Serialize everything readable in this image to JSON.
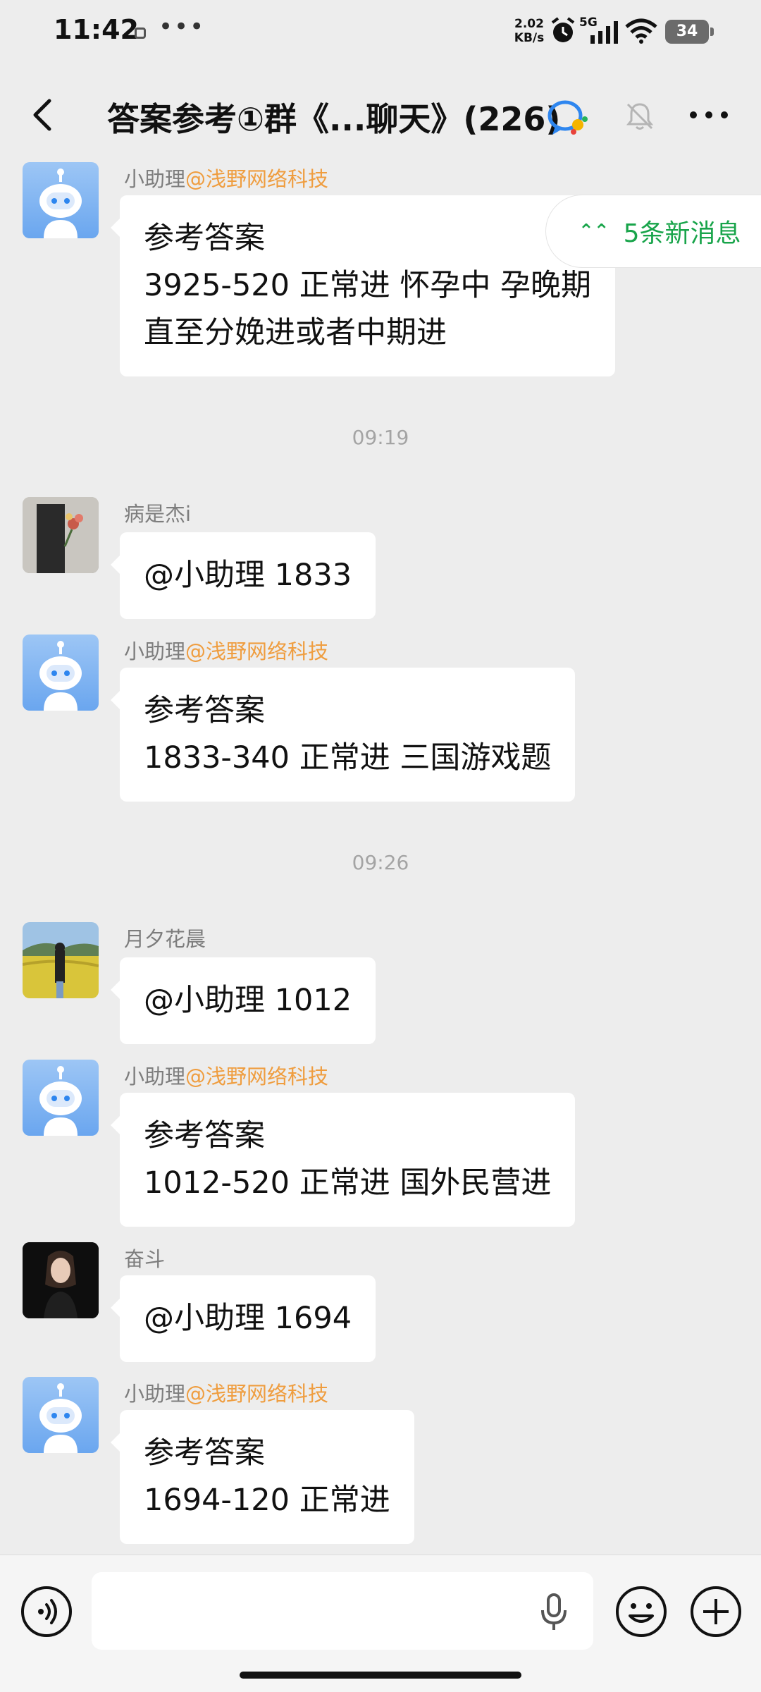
{
  "status_bar": {
    "time": "11:42",
    "net_speed_value": "2.02",
    "net_speed_unit": "KB/s",
    "network": "5G",
    "battery": "34",
    "icons": [
      "notification-icon",
      "alarm-icon",
      "signal-icon",
      "wifi-icon",
      "battery-icon"
    ]
  },
  "header": {
    "title": "答案参考①群《...聊天》(226)",
    "icons": [
      "back-icon",
      "group-badge-icon",
      "mute-bell-icon",
      "more-icon"
    ]
  },
  "new_messages_pill": {
    "label": "5条新消息",
    "icon": "double-chevron-up-icon"
  },
  "messages": [
    {
      "sender": "小助理",
      "org": "@浅野网络科技",
      "avatar": "robot",
      "lines": [
        "参考答案",
        "3925-520 正常进 怀孕中 孕晚期",
        "直至分娩进或者中期进"
      ]
    },
    {
      "timestamp": "09:19"
    },
    {
      "sender": "病是杰i",
      "avatar": "photo-flowers",
      "lines": [
        "@小助理  1833"
      ]
    },
    {
      "sender": "小助理",
      "org": "@浅野网络科技",
      "avatar": "robot",
      "lines": [
        "参考答案",
        "1833-340 正常进 三国游戏题"
      ]
    },
    {
      "timestamp": "09:26"
    },
    {
      "sender": "月夕花晨",
      "avatar": "photo-field",
      "lines": [
        "@小助理  1012"
      ]
    },
    {
      "sender": "小助理",
      "org": "@浅野网络科技",
      "avatar": "robot",
      "lines": [
        "参考答案",
        "1012-520 正常进 国外民营进"
      ]
    },
    {
      "sender": "奋斗",
      "avatar": "photo-portrait",
      "lines": [
        "@小助理  1694"
      ]
    },
    {
      "sender": "小助理",
      "org": "@浅野网络科技",
      "avatar": "robot",
      "lines": [
        "参考答案",
        "1694-120 正常进"
      ]
    }
  ],
  "input_bar": {
    "message_input": "",
    "icons": [
      "voice-icon",
      "mic-icon",
      "emoji-icon",
      "plus-icon"
    ]
  },
  "colors": {
    "background": "#ededed",
    "bubble": "#ffffff",
    "org_accent": "#ef9d3f",
    "new_msg_accent": "#18a44a",
    "timestamp": "#a4a4a4"
  }
}
